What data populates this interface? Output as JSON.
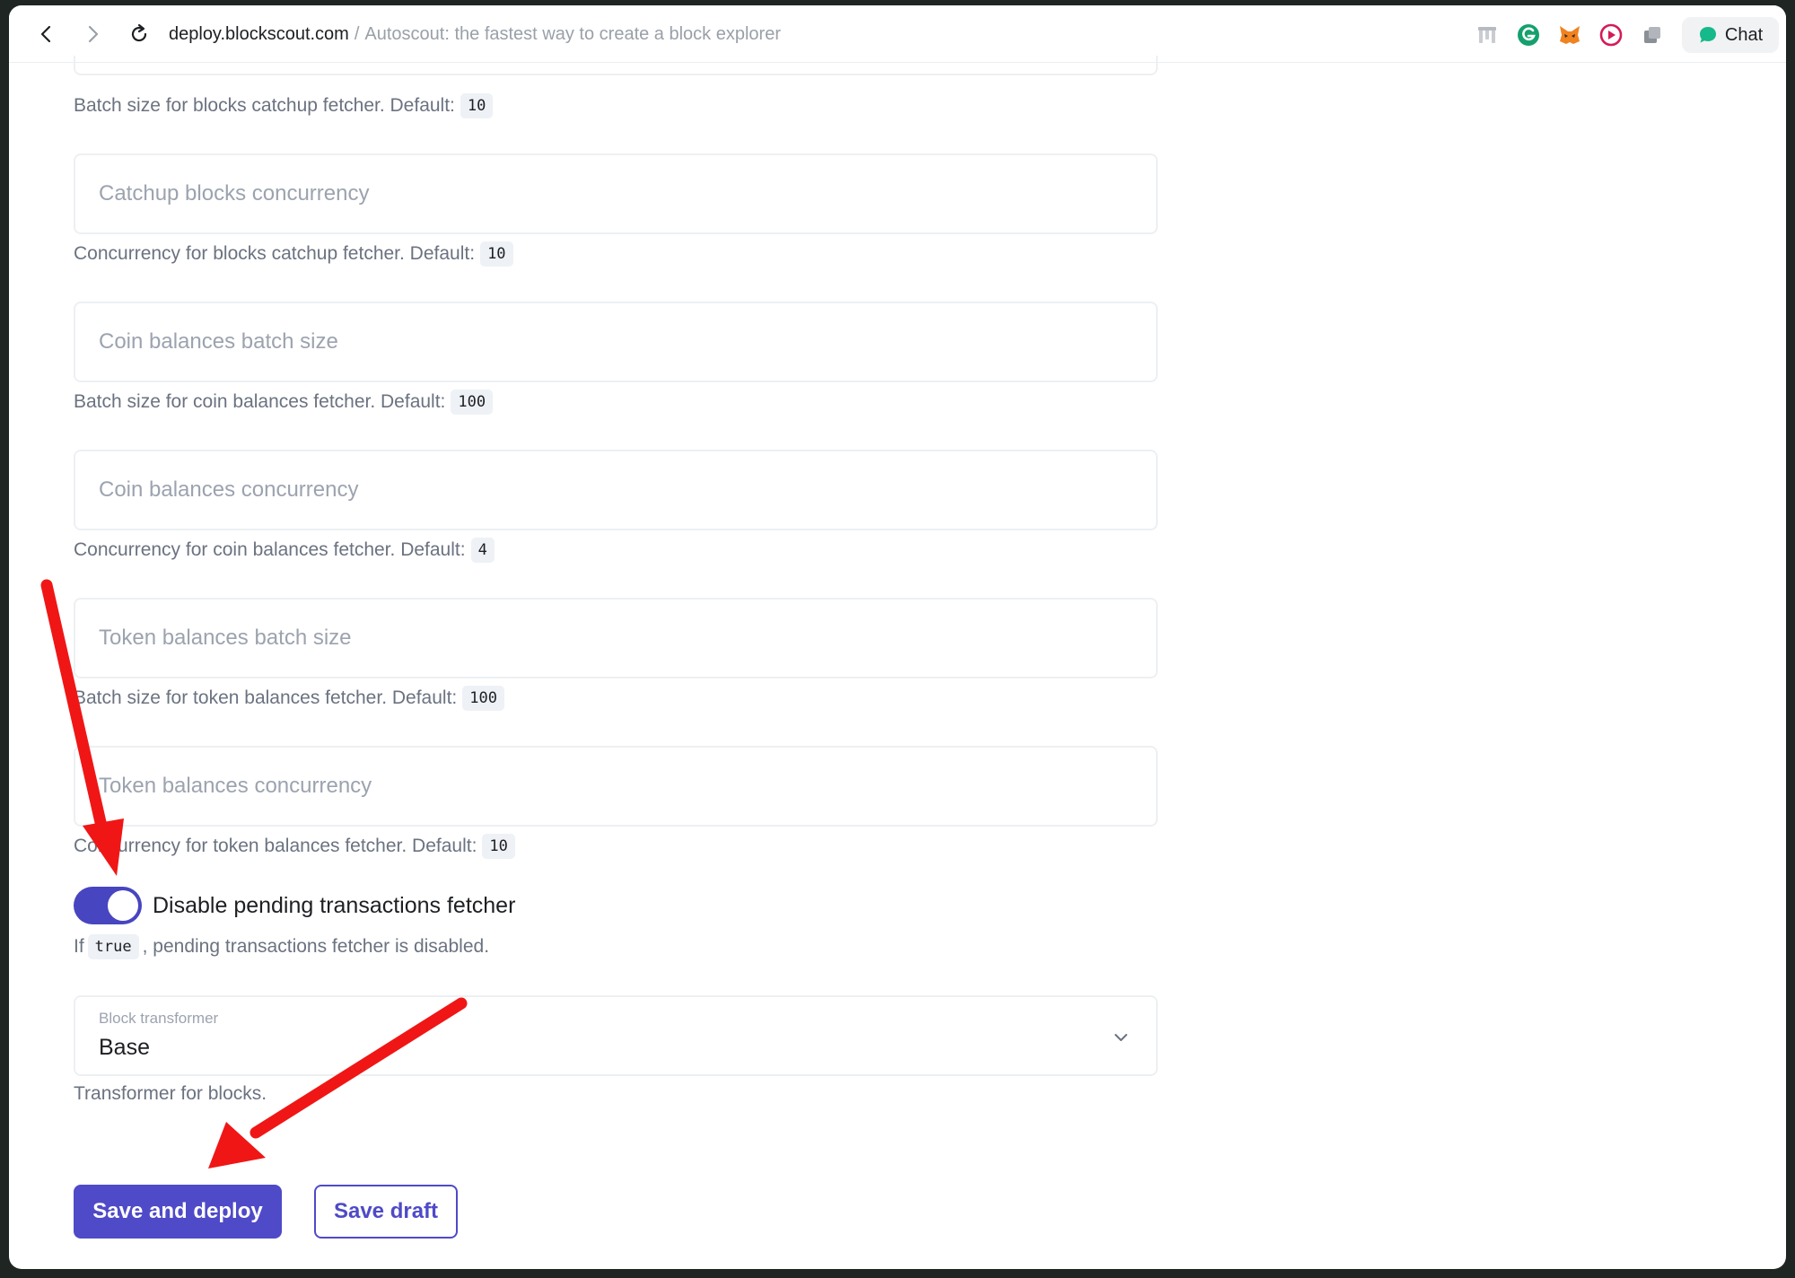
{
  "browser": {
    "url_host": "deploy.blockscout.com",
    "url_separator": "/",
    "page_title": "Autoscout: the fastest way to create a block explorer",
    "chat_label": "Chat"
  },
  "form": {
    "top_help": {
      "text": "Batch size for blocks catchup fetcher. Default:",
      "default": "10"
    },
    "fields": [
      {
        "placeholder": "Catchup blocks concurrency",
        "help": "Concurrency for blocks catchup fetcher. Default:",
        "default": "10"
      },
      {
        "placeholder": "Coin balances batch size",
        "help": "Batch size for coin balances fetcher. Default:",
        "default": "100"
      },
      {
        "placeholder": "Coin balances concurrency",
        "help": "Concurrency for coin balances fetcher. Default:",
        "default": "4"
      },
      {
        "placeholder": "Token balances batch size",
        "help": "Batch size for token balances fetcher. Default:",
        "default": "100"
      },
      {
        "placeholder": "Token balances concurrency",
        "help": "Concurrency for token balances fetcher. Default:",
        "default": "10"
      }
    ],
    "toggle": {
      "label": "Disable pending transactions fetcher",
      "checked": true,
      "help_prefix": "If",
      "help_code": "true",
      "help_suffix": ", pending transactions fetcher is disabled."
    },
    "select": {
      "label": "Block transformer",
      "value": "Base",
      "help": "Transformer for blocks."
    },
    "buttons": {
      "primary": "Save and deploy",
      "secondary": "Save draft"
    }
  },
  "colors": {
    "accent": "#4f4ac7",
    "toggle_on": "#4845c0",
    "annotation_arrow": "#f01616"
  }
}
